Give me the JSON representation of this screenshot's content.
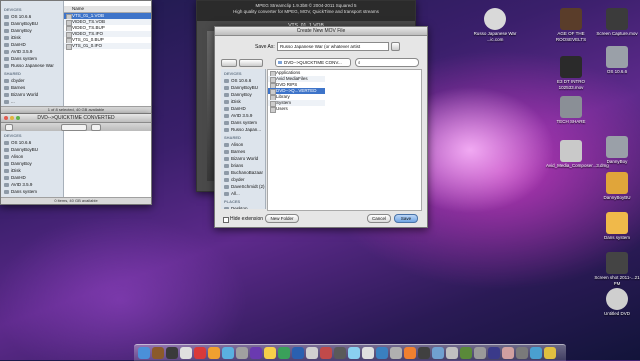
{
  "finder_top": {
    "sidebar_heads": [
      "DEVICES",
      "SHARED"
    ],
    "devices": [
      "OS 10.6.6",
      "DannyBoyBU",
      "DannyBoy",
      "iDisk",
      "DanHD",
      "AVID 3.5.9",
      "Dans system",
      "Russo Japanese War"
    ],
    "shared": [
      "cbyder",
      "Barnes",
      "Bizarro World",
      "..."
    ],
    "column_header": "Name",
    "files": [
      "VTS_01_1.VOB",
      "VIDEO_TS.VOB",
      "VIDEO_TS.BUP",
      "VIDEO_TS.IFO",
      "VTS_01_0.BUP",
      "VTS_01_0.IFO"
    ],
    "status": "1 of 8 selected, 40 GB available"
  },
  "finder_bottom": {
    "title": "DVD-->QUICKTIME CONVERTED",
    "sidebar_head": "DEVICES",
    "devices": [
      "OS 10.6.6",
      "DannyBoyBU",
      "Alison",
      "DannyBoy",
      "iDisk",
      "DanHD",
      "AVID 3.5.9",
      "Dans system",
      "Russo Japanese War"
    ],
    "status": "0 items, 40 GB available"
  },
  "converter": {
    "header1": "MPEG Streamclip 1.9.3b8 © 2004-2011 Squared 5",
    "header2": "High quality converter for MPEG, MOV, QuickTime and transport streams",
    "file": "VTS_01_1.VOB"
  },
  "dialog": {
    "title": "Create New MOV File",
    "save_as_label": "Save As:",
    "save_as_value": "Russo Japanese War (or whatever artist",
    "location": "DVD-->QUICKTIME CONV...",
    "search_placeholder": "",
    "sidebar_heads": [
      "DEVICES",
      "SHARED",
      "PLACES"
    ],
    "devices": [
      "OS 10.6.6",
      "DannyBoyBU",
      "DannyBoy",
      "iDisk",
      "DanHD",
      "AVID 3.5.9",
      "Dans system",
      "Russo Japan..."
    ],
    "shared": [
      "Alison",
      "Barnes",
      "Bizarro World",
      "brians",
      "BuchanoBazaar",
      "cbyder",
      "DaveSchmidt (2)",
      "All..."
    ],
    "places": [
      "Desktop",
      "Downloads"
    ],
    "column1": [
      "Applications",
      "Avid MediaFiles",
      "DVD RIPS",
      "DVD-->Q...VERTED",
      "Library",
      "System",
      "Users"
    ],
    "hide_extension": "Hide extension",
    "new_folder": "New Folder",
    "cancel": "Cancel",
    "save": "Save"
  },
  "desktop_icons": [
    "Russo Japanese War ...ic.com",
    "AGE OF THE ROOSEVELTS",
    "Screen Capture.mov",
    "OS 10.6.6",
    "E3 DT INTRO 102533.mov",
    "TECH SHARE",
    "Avid_Media_Composer...3.dmg",
    "DannyBoy",
    "DannyBoyBU",
    "Dans system",
    "Screen shot 2011-...21 PM",
    "Untitled DVD"
  ],
  "colors": {
    "accent": "#6fa4e3",
    "selection": "#7ea4d9",
    "desktop_magenta": "#d83cc8"
  }
}
